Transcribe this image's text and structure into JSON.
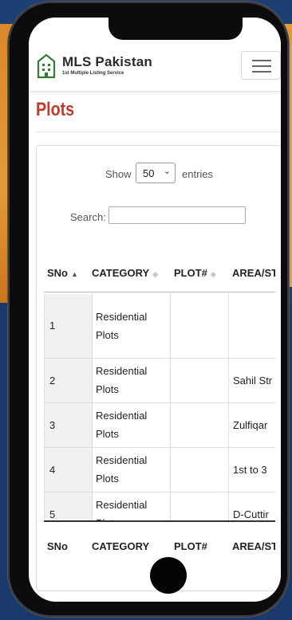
{
  "header": {
    "brand": "MLS Pakistan",
    "tagline": "1st Multiple Listing Service"
  },
  "page": {
    "title": "Plots"
  },
  "controls": {
    "show_label": "Show",
    "entries_value": "50",
    "entries_label": "entries",
    "search_label": "Search:",
    "search_value": ""
  },
  "table": {
    "columns": [
      "SNo",
      "CATEGORY",
      "PLOT#",
      "AREA/ST"
    ],
    "rows": [
      {
        "sno": "1",
        "category": "Residential Plots",
        "plot": "",
        "area": ""
      },
      {
        "sno": "2",
        "category": "Residential Plots",
        "plot": "",
        "area": "Sahil Str"
      },
      {
        "sno": "3",
        "category": "Residential Plots",
        "plot": "",
        "area": "Zulfiqar"
      },
      {
        "sno": "4",
        "category": "Residential Plots",
        "plot": "",
        "area": "1st to 3"
      },
      {
        "sno": "5",
        "category": "Residential Plots",
        "plot": "",
        "area": "D-Cuttir"
      }
    ],
    "footer": [
      "SNo",
      "CATEGORY",
      "PLOT#",
      "AREA/ST"
    ]
  },
  "icons": {
    "logo": "building-icon",
    "menu": "hamburger-menu-icon",
    "sort": "sort-arrows-icon"
  },
  "colors": {
    "title": "#c0392b",
    "logo_green": "#2e7d32"
  }
}
